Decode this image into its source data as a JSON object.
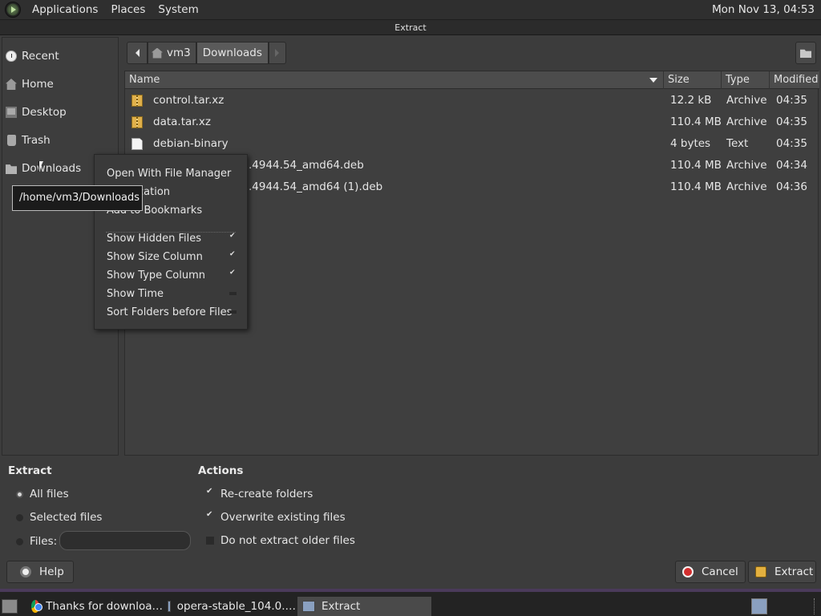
{
  "top_panel": {
    "menus": [
      "Applications",
      "Places",
      "System"
    ],
    "clock": "Mon Nov 13, 04:53"
  },
  "window": {
    "title": "Extract"
  },
  "sidebar": {
    "items": [
      {
        "label": "Recent",
        "icon": "recent-icon"
      },
      {
        "label": "Home",
        "icon": "home-icon"
      },
      {
        "label": "Desktop",
        "icon": "desktop-icon"
      },
      {
        "label": "Trash",
        "icon": "trash-icon"
      },
      {
        "label": "Downloads",
        "icon": "folder-icon"
      }
    ]
  },
  "pathbar": {
    "segments": [
      "vm3",
      "Downloads"
    ]
  },
  "file_list": {
    "columns": [
      "Name",
      "Size",
      "Type",
      "Modified"
    ],
    "rows": [
      {
        "name": "control.tar.xz",
        "size": "12.2 kB",
        "type": "Archive",
        "modified": "04:35",
        "icon": "archive-icon"
      },
      {
        "name": "data.tar.xz",
        "size": "110.4 MB",
        "type": "Archive",
        "modified": "04:35",
        "icon": "archive-icon"
      },
      {
        "name": "debian-binary",
        "size": "4 bytes",
        "type": "Text",
        "modified": "04:35",
        "icon": "text-file-icon"
      },
      {
        "name": ".4944.54_amd64.deb",
        "size": "110.4 MB",
        "type": "Archive",
        "modified": "04:34",
        "icon": "archive-icon"
      },
      {
        "name": ".4944.54_amd64 (1).deb",
        "size": "110.4 MB",
        "type": "Archive",
        "modified": "04:36",
        "icon": "archive-icon"
      }
    ]
  },
  "context_menu": {
    "items": [
      {
        "label": "Open With File Manager"
      },
      {
        "label": "cation"
      },
      {
        "label": "Add to Bookmarks"
      },
      {
        "label": "Show Hidden Files",
        "checked": true
      },
      {
        "label": "Show Size Column",
        "checked": true
      },
      {
        "label": "Show Type Column",
        "checked": true
      },
      {
        "label": "Show Time",
        "checked": false
      },
      {
        "label": "Sort Folders before Files",
        "checked": false
      }
    ]
  },
  "tooltip": {
    "text": "/home/vm3/Downloads"
  },
  "extract_options": {
    "title": "Extract",
    "all_files": "All files",
    "selected_files": "Selected files",
    "files_label": "Files:",
    "files_value": ""
  },
  "actions": {
    "title": "Actions",
    "recreate_folders": "Re-create folders",
    "overwrite_existing": "Overwrite existing files",
    "do_not_extract_older": "Do not extract older files"
  },
  "buttons": {
    "help": "Help",
    "cancel": "Cancel",
    "extract": "Extract"
  },
  "taskbar": {
    "items": [
      {
        "label": "Thanks for downloa…",
        "icon": "chrome-icon"
      },
      {
        "label": "opera-stable_104.0.…",
        "icon": "archive-manager-icon"
      },
      {
        "label": "Extract",
        "icon": "archive-manager-icon",
        "active": true
      }
    ]
  }
}
